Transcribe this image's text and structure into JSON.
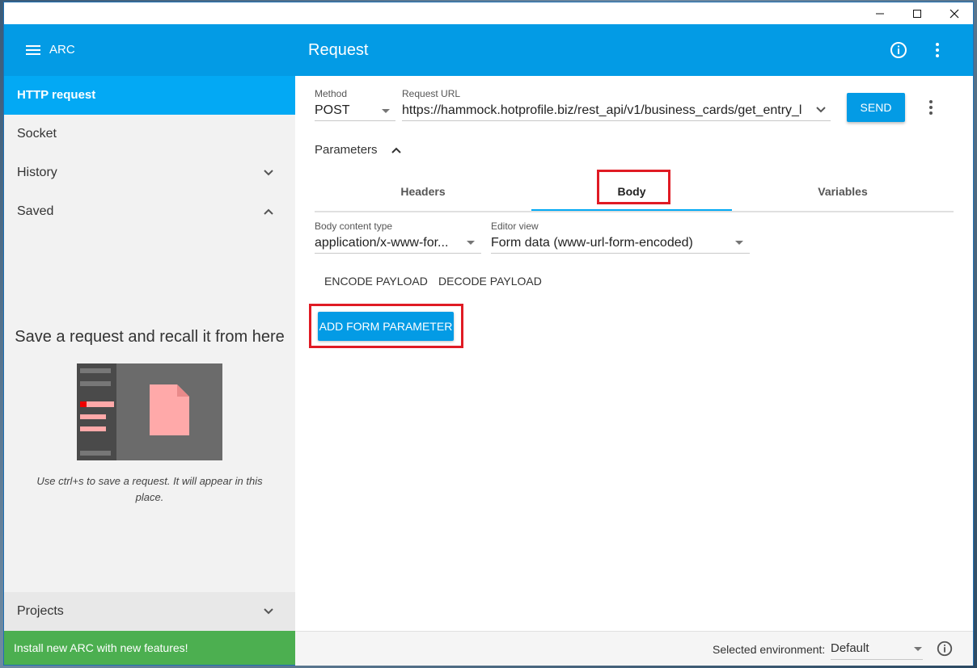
{
  "window": {
    "controls": [
      "minimize-icon",
      "maximize-icon",
      "close-icon"
    ]
  },
  "sidebar": {
    "app_title": "ARC",
    "items": [
      {
        "label": "HTTP request",
        "active": true
      },
      {
        "label": "Socket"
      },
      {
        "label": "History",
        "icon": "chevron-down-icon"
      },
      {
        "label": "Saved",
        "icon": "chevron-up-icon"
      }
    ],
    "empty_state": {
      "title": "Save a request and recall it from here",
      "hint": "Use ctrl+s to save a request. It will appear in this place."
    },
    "projects_label": "Projects",
    "install_banner": "Install new ARC with new features!"
  },
  "main": {
    "title": "Request",
    "method": {
      "label": "Method",
      "value": "POST"
    },
    "url": {
      "label": "Request URL",
      "value": "https://hammock.hotprofile.biz/rest_api/v1/business_cards/get_entry_l"
    },
    "send_label": "SEND",
    "parameters_label": "Parameters",
    "tabs": [
      {
        "label": "Headers"
      },
      {
        "label": "Body",
        "active": true
      },
      {
        "label": "Variables"
      }
    ],
    "body_content_type": {
      "label": "Body content type",
      "value": "application/x-www-for..."
    },
    "editor_view": {
      "label": "Editor view",
      "value": "Form data (www-url-form-encoded)"
    },
    "encode_label": "ENCODE PAYLOAD",
    "decode_label": "DECODE PAYLOAD",
    "add_param_label": "ADD FORM PARAMETER"
  },
  "footer": {
    "env_label": "Selected environment:",
    "env_value": "Default"
  },
  "colors": {
    "accent": "#039be5",
    "active_nav": "#03a9f4",
    "banner": "#4caf50",
    "highlight": "#e01b24"
  }
}
